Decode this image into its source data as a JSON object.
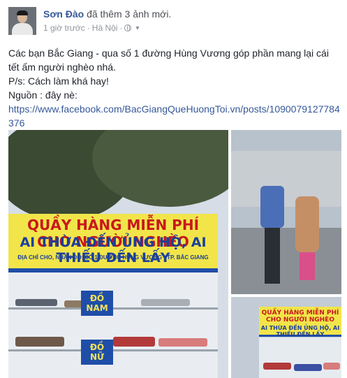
{
  "post": {
    "author": "Sơn Đào",
    "action": "đã thêm 3 ảnh mới.",
    "time": "1 giờ trước",
    "separator": "·",
    "location": "Hà Nội",
    "privacy_icon": "globe-icon",
    "privacy_dropdown_icon": "chevron-down-icon"
  },
  "content": {
    "line1": "Các bạn Bắc Giang - qua số 1 đường Hùng Vương góp phần mang lại cái tết ấm người nghèo nhá.",
    "line2": "P/s: Cách làm khá hay!",
    "line3": "Nguồn : đây nè:",
    "link": "https://www.facebook.com/BacGiangQueHuongToi.vn/posts/1090079127784376"
  },
  "photos": {
    "photo1": {
      "banner_line1": "QUẦY HÀNG MIỄN PHÍ CHO NGƯỜI NGHÈO",
      "banner_line2": "AI THỪA ĐẾN ỦNG HỘ, AI THIẾU ĐẾN LẤY",
      "banner_line3": "ĐỊA CHỈ CHO, NHẬN ĐỒ: SỐ 1 ĐƯỜNG HÙNG VƯƠNG - TP. BẮC GIANG",
      "label_men": "ĐỒ NAM",
      "label_women": "ĐỒ NỮ"
    },
    "photo3": {
      "banner_line1": "QUẦY HÀNG MIỄN PHÍ CHO NGƯỜI NGHÈO",
      "banner_line2": "AI THỪA ĐẾN ỦNG HỘ, AI THIẾU ĐẾN LẤY"
    }
  },
  "colors": {
    "author": "#365899",
    "link": "#365899",
    "banner_yellow": "#f1e54a",
    "banner_red": "#c8181c",
    "banner_blue": "#1b3f9b"
  }
}
